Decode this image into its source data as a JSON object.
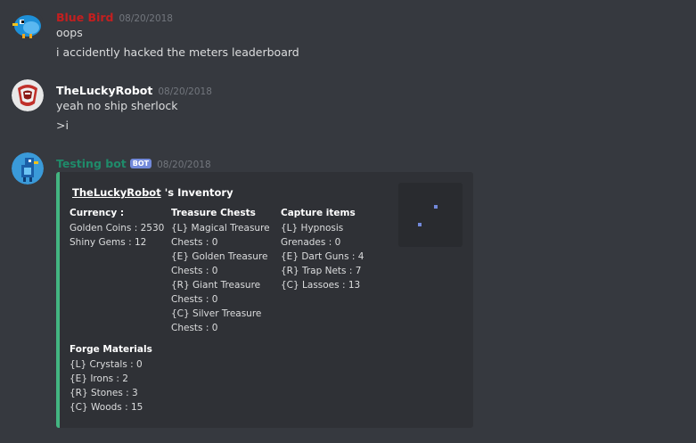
{
  "messages": [
    {
      "author": "Blue Bird",
      "author_color": "#c41f1f",
      "timestamp": "08/20/2018",
      "lines": [
        "oops",
        "i accidently hacked the meters leaderboard"
      ],
      "avatar_icon": "blue-bird-avatar"
    },
    {
      "author": "TheLuckyRobot",
      "author_color": "#ffffff",
      "timestamp": "08/20/2018",
      "lines": [
        "yeah no ship sherlock",
        ">i"
      ],
      "avatar_icon": "robot-avatar"
    },
    {
      "author": "Testing bot",
      "author_color": "#1f8b6a",
      "bot_tag": "BOT",
      "timestamp": "08/20/2018",
      "avatar_icon": "bot-avatar"
    }
  ],
  "embed": {
    "title_user": "TheLuckyRobot",
    "title_rest": " 's Inventory",
    "accent_color": "#43b581",
    "fields": {
      "currency": {
        "name": "Currency :",
        "lines": [
          "Golden Coins : 2530",
          "Shiny Gems : 12"
        ]
      },
      "chests": {
        "name": "Treasure Chests",
        "lines": [
          "{L} Magical Treasure",
          "Chests : 0",
          "{E} Golden Treasure",
          "Chests : 0",
          "{R} Giant Treasure",
          "Chests : 0",
          "{C} Silver Treasure",
          "Chests : 0"
        ]
      },
      "capture": {
        "name": "Capture items",
        "lines": [
          "{L} Hypnosis",
          "Grenades : 0",
          "{E} Dart Guns : 4",
          "{R} Trap Nets : 7",
          "{C} Lassoes : 13"
        ]
      },
      "forge": {
        "name": "Forge Materials",
        "lines": [
          "{L} Crystals : 0",
          "{E} Irons : 2",
          "{R} Stones : 3",
          "{C} Woods : 15"
        ]
      }
    }
  }
}
